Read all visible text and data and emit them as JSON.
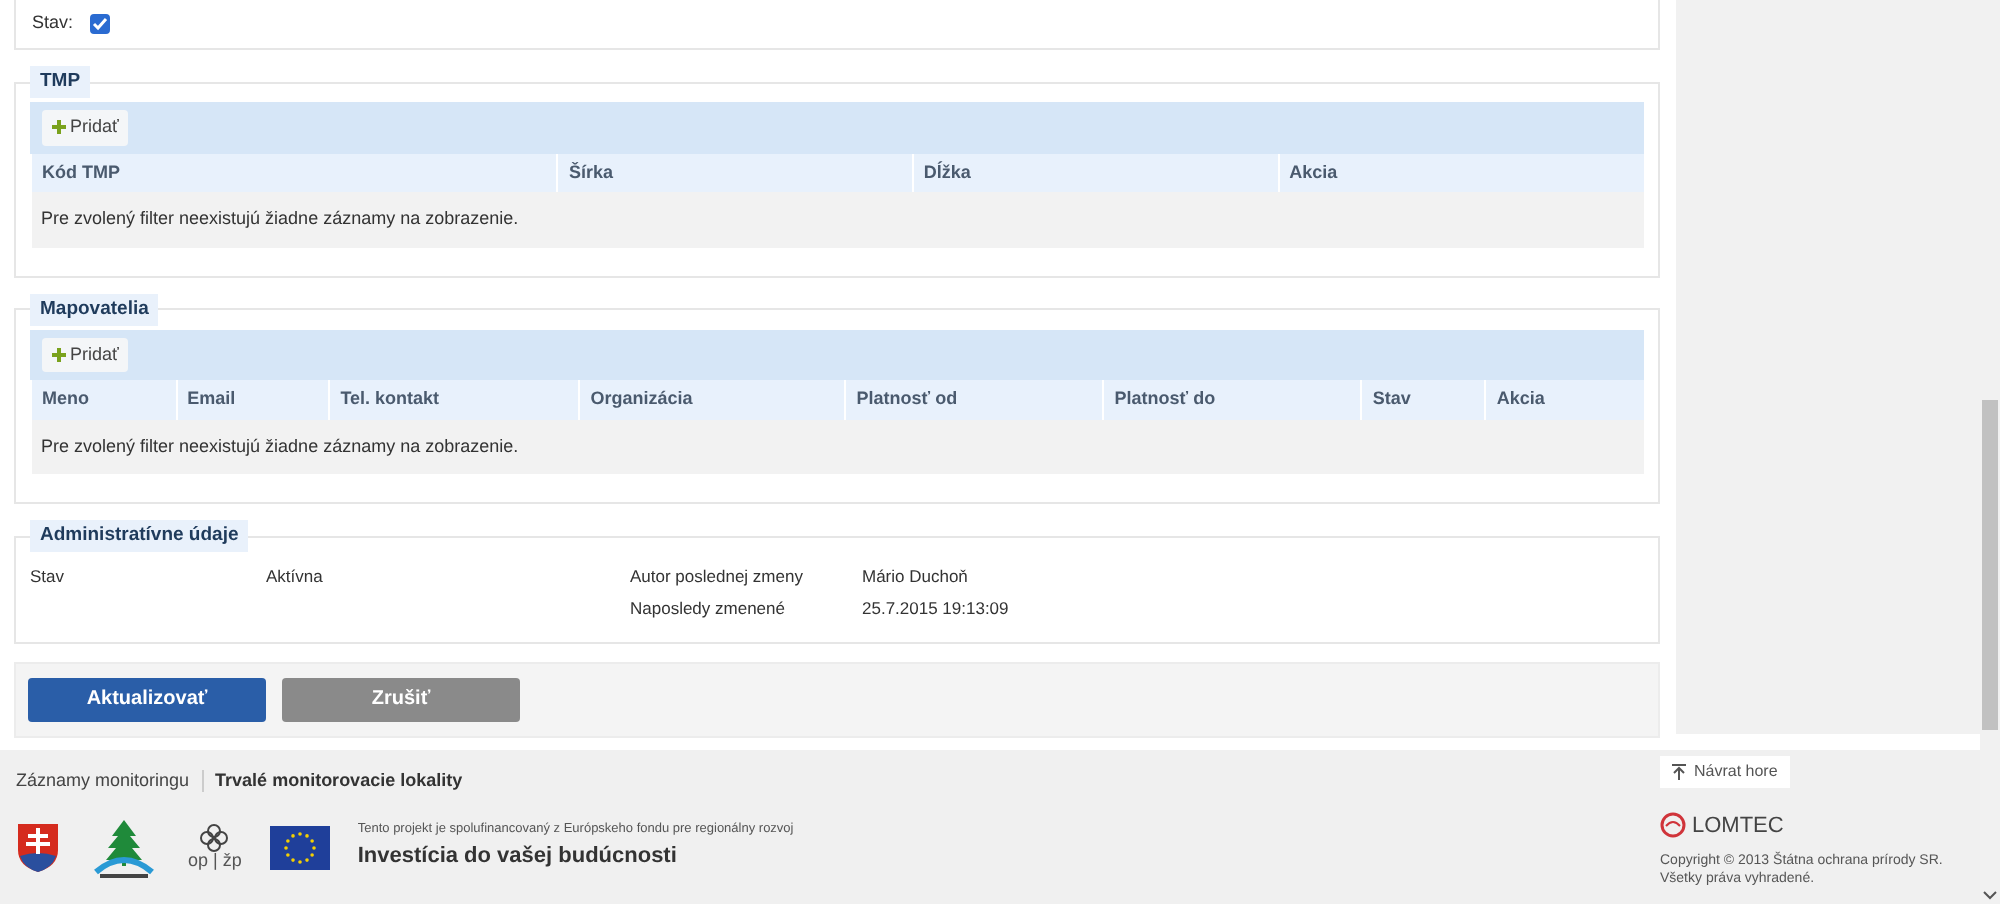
{
  "status_field": {
    "label": "Stav:",
    "checked": true
  },
  "sections": [
    {
      "kind": "table",
      "title": "TMP",
      "add_button": "Pridať",
      "columns": [
        "Kód TMP",
        "Šírka",
        "Dĺžka",
        "Akcia"
      ],
      "empty_message": "Pre zvolený filter neexistujú žiadne záznamy na zobrazenie."
    },
    {
      "kind": "table",
      "title": "Mapovatelia",
      "add_button": "Pridať",
      "columns": [
        "Meno",
        "Email",
        "Tel. kontakt",
        "Organizácia",
        "Platnosť od",
        "Platnosť do",
        "Stav",
        "Akcia"
      ],
      "empty_message": "Pre zvolený filter neexistujú žiadne záznamy na zobrazenie."
    },
    {
      "kind": "details",
      "title": "Administratívne údaje",
      "left_fields": [
        {
          "label": "Stav",
          "value": "Aktívna"
        }
      ],
      "right_fields": [
        {
          "label": "Autor poslednej zmeny",
          "value": "Mário Duchoň"
        },
        {
          "label": "Naposledy zmenené",
          "value": "25.7.2015 19:13:09"
        }
      ]
    }
  ],
  "buttons": [
    {
      "label": "Aktualizovať",
      "kind": "primary"
    },
    {
      "label": "Zrušiť",
      "kind": "secondary"
    }
  ],
  "footer": {
    "links": [
      {
        "label": "Záznamy monitoringu",
        "selected": false
      },
      {
        "label": "Trvalé monitorovacie lokality",
        "selected": true
      }
    ],
    "op_logo": "op | žp",
    "project_note": "Tento projekt je spolufinancovaný z Európskeho fondu pre regionálny rozvoj",
    "slogan": "Investícia do vašej budúcnosti",
    "back_to_top": "Návrat hore",
    "brand": "LOMTEC",
    "copyright": "Copyright © 2013 Štátna ochrana prírody SR.",
    "rights": "Všetky práva vyhradené."
  }
}
